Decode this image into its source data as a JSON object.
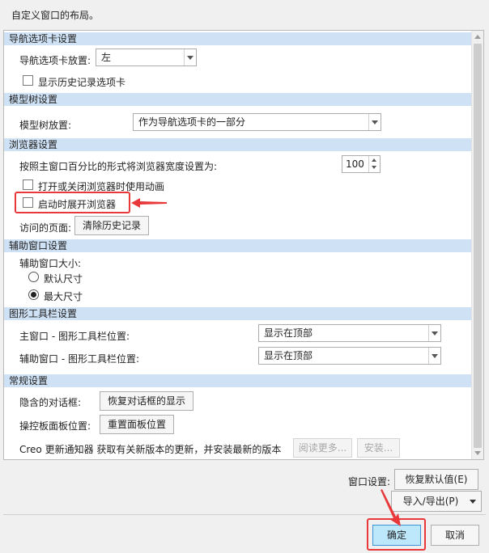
{
  "description": "自定义窗口的布局。",
  "sections": {
    "nav_tabs": "导航选项卡设置",
    "model_tree": "模型树设置",
    "browser": "浏览器设置",
    "aux_window": "辅助窗口设置",
    "graphics_toolbar": "图形工具栏设置",
    "general": "常规设置"
  },
  "nav_tabs": {
    "placement_label": "导航选项卡放置:",
    "placement_value": "左",
    "show_history_label": "显示历史记录选项卡"
  },
  "model_tree": {
    "placement_label": "模型树放置:",
    "placement_value": "作为导航选项卡的一部分"
  },
  "browser": {
    "width_label": "按照主窗口百分比的形式将浏览器宽度设置为:",
    "width_value": "100",
    "animate_label": "打开或关闭浏览器时使用动画",
    "expand_label": "启动时展开浏览器",
    "visited_label": "访问的页面:",
    "clear_history": "清除历史记录"
  },
  "aux_window": {
    "size_label": "辅助窗口大小:",
    "default_size": "默认尺寸",
    "max_size": "最大尺寸"
  },
  "graphics_toolbar": {
    "main_label": "主窗口 - 图形工具栏位置:",
    "main_value": "显示在顶部",
    "aux_label": "辅助窗口 - 图形工具栏位置:",
    "aux_value": "显示在顶部"
  },
  "general": {
    "hidden_dialogs_label": "隐含的对话框:",
    "restore_dialogs": "恢复对话框的显示",
    "dashboard_label": "操控板面板位置:",
    "reset_panel": "重置面板位置",
    "updater_text": "Creo 更新通知器  获取有关新版本的更新，并安装最新的版本",
    "read_more": "阅读更多...",
    "install": "安装..."
  },
  "window_settings": {
    "label": "窗口设置:",
    "restore_defaults": "恢复默认值(E)",
    "import_export": "导入/导出(P)"
  },
  "dialog": {
    "ok": "确定",
    "cancel": "取消"
  }
}
